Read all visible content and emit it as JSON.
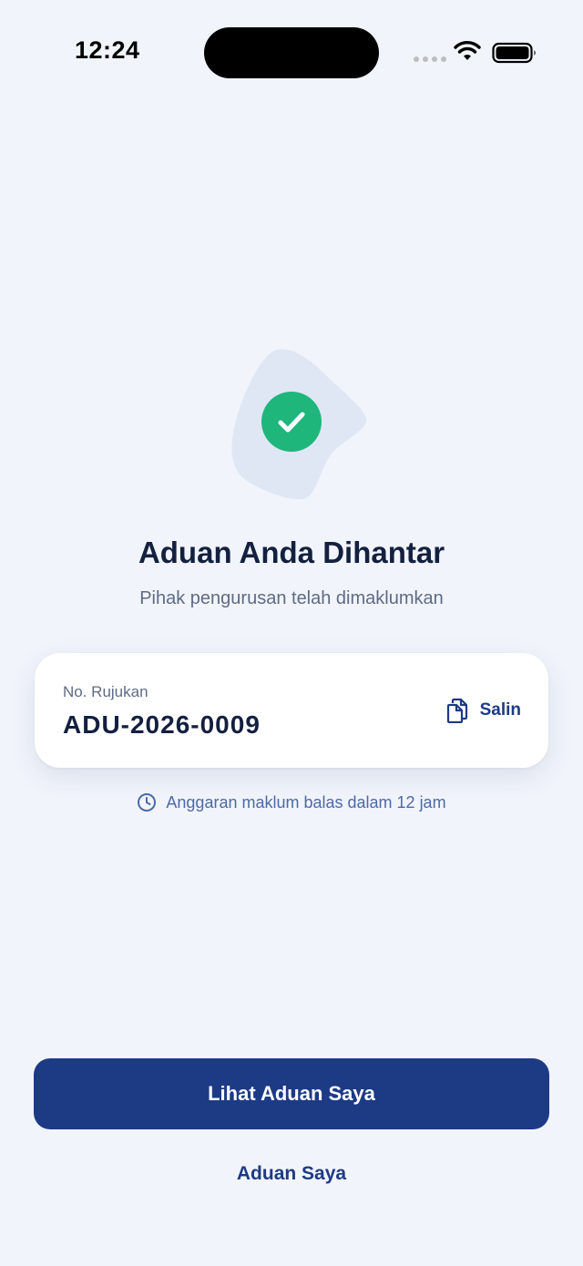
{
  "status_bar": {
    "time": "12:24",
    "icons": [
      "signal-dots-icon",
      "wifi-icon",
      "battery-icon"
    ]
  },
  "confirmation": {
    "icon": "check-circle-icon",
    "title": "Aduan Anda Dihantar",
    "subtitle": "Pihak pengurusan telah dimaklumkan"
  },
  "reference_card": {
    "label": "No. Rujukan",
    "number": "ADU-2026-0009",
    "copy_icon": "copy-icon",
    "copy_label": "Salin"
  },
  "eta": {
    "icon": "clock-icon",
    "text": "Anggaran maklum balas dalam 12 jam"
  },
  "actions": {
    "primary_label": "Lihat Aduan Saya",
    "secondary_label": "Aduan Saya"
  },
  "colors": {
    "background": "#f1f4fb",
    "primary": "#1d3a85",
    "success": "#1fb67c",
    "text_dark": "#13203f",
    "text_muted": "#5f6b84",
    "eta_text": "#4c6aa8"
  }
}
